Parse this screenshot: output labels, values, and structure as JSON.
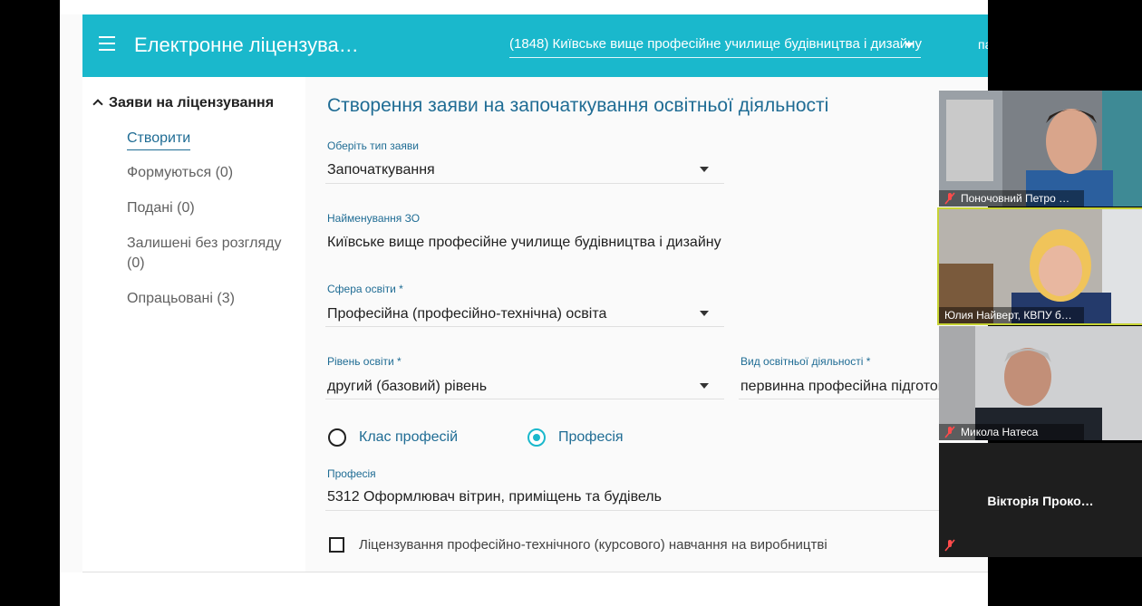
{
  "app": {
    "title": "Електронне ліцензува…",
    "organization": "(1848) Київське вище професійне училище будівництва і дизайну",
    "appbar_right": "па"
  },
  "sidebar": {
    "section": "Заяви на ліцензування",
    "items": [
      {
        "label": "Створити"
      },
      {
        "label": "Формуються (0)"
      },
      {
        "label": "Подані (0)"
      },
      {
        "label": "Залишені без розгляду (0)"
      },
      {
        "label": "Опрацьовані (3)"
      }
    ]
  },
  "form": {
    "title": "Створення заяви на започаткування освітньої діяльності",
    "application_type": {
      "label": "Оберіть тип заяви",
      "value": "Започаткування"
    },
    "institution_name": {
      "label": "Найменування ЗО",
      "value": "Київське вище професійне училище будівництва і дизайну"
    },
    "education_sphere": {
      "label": "Сфера освіти *",
      "value": "Професійна (професійно-технічна) освіта"
    },
    "education_level": {
      "label": "Рівень освіти *",
      "value": "другий (базовий) рівень"
    },
    "activity_type": {
      "label": "Вид освітньої діяльності *",
      "value": "первинна професійна підготовка"
    },
    "radio_options": [
      {
        "label": "Клас професій",
        "selected": false
      },
      {
        "label": "Професія",
        "selected": true
      }
    ],
    "profession": {
      "label": "Професія",
      "value": "5312 Оформлювач вітрин, приміщень та будівель"
    },
    "checkbox": {
      "label": "Ліцензування професійно-технічного (курсового) навчання на виробництві",
      "checked": false
    }
  },
  "participants": [
    {
      "name": "Поночовний Петро …",
      "muted": true
    },
    {
      "name": "Юлия Найверт, КВПУ б…",
      "muted": false
    },
    {
      "name": "Микола Натеса",
      "muted": true
    },
    {
      "name": "Вікторія  Проко…",
      "muted": true
    }
  ],
  "colors": {
    "accent": "#1ab8cc",
    "link": "#1f6c94"
  }
}
